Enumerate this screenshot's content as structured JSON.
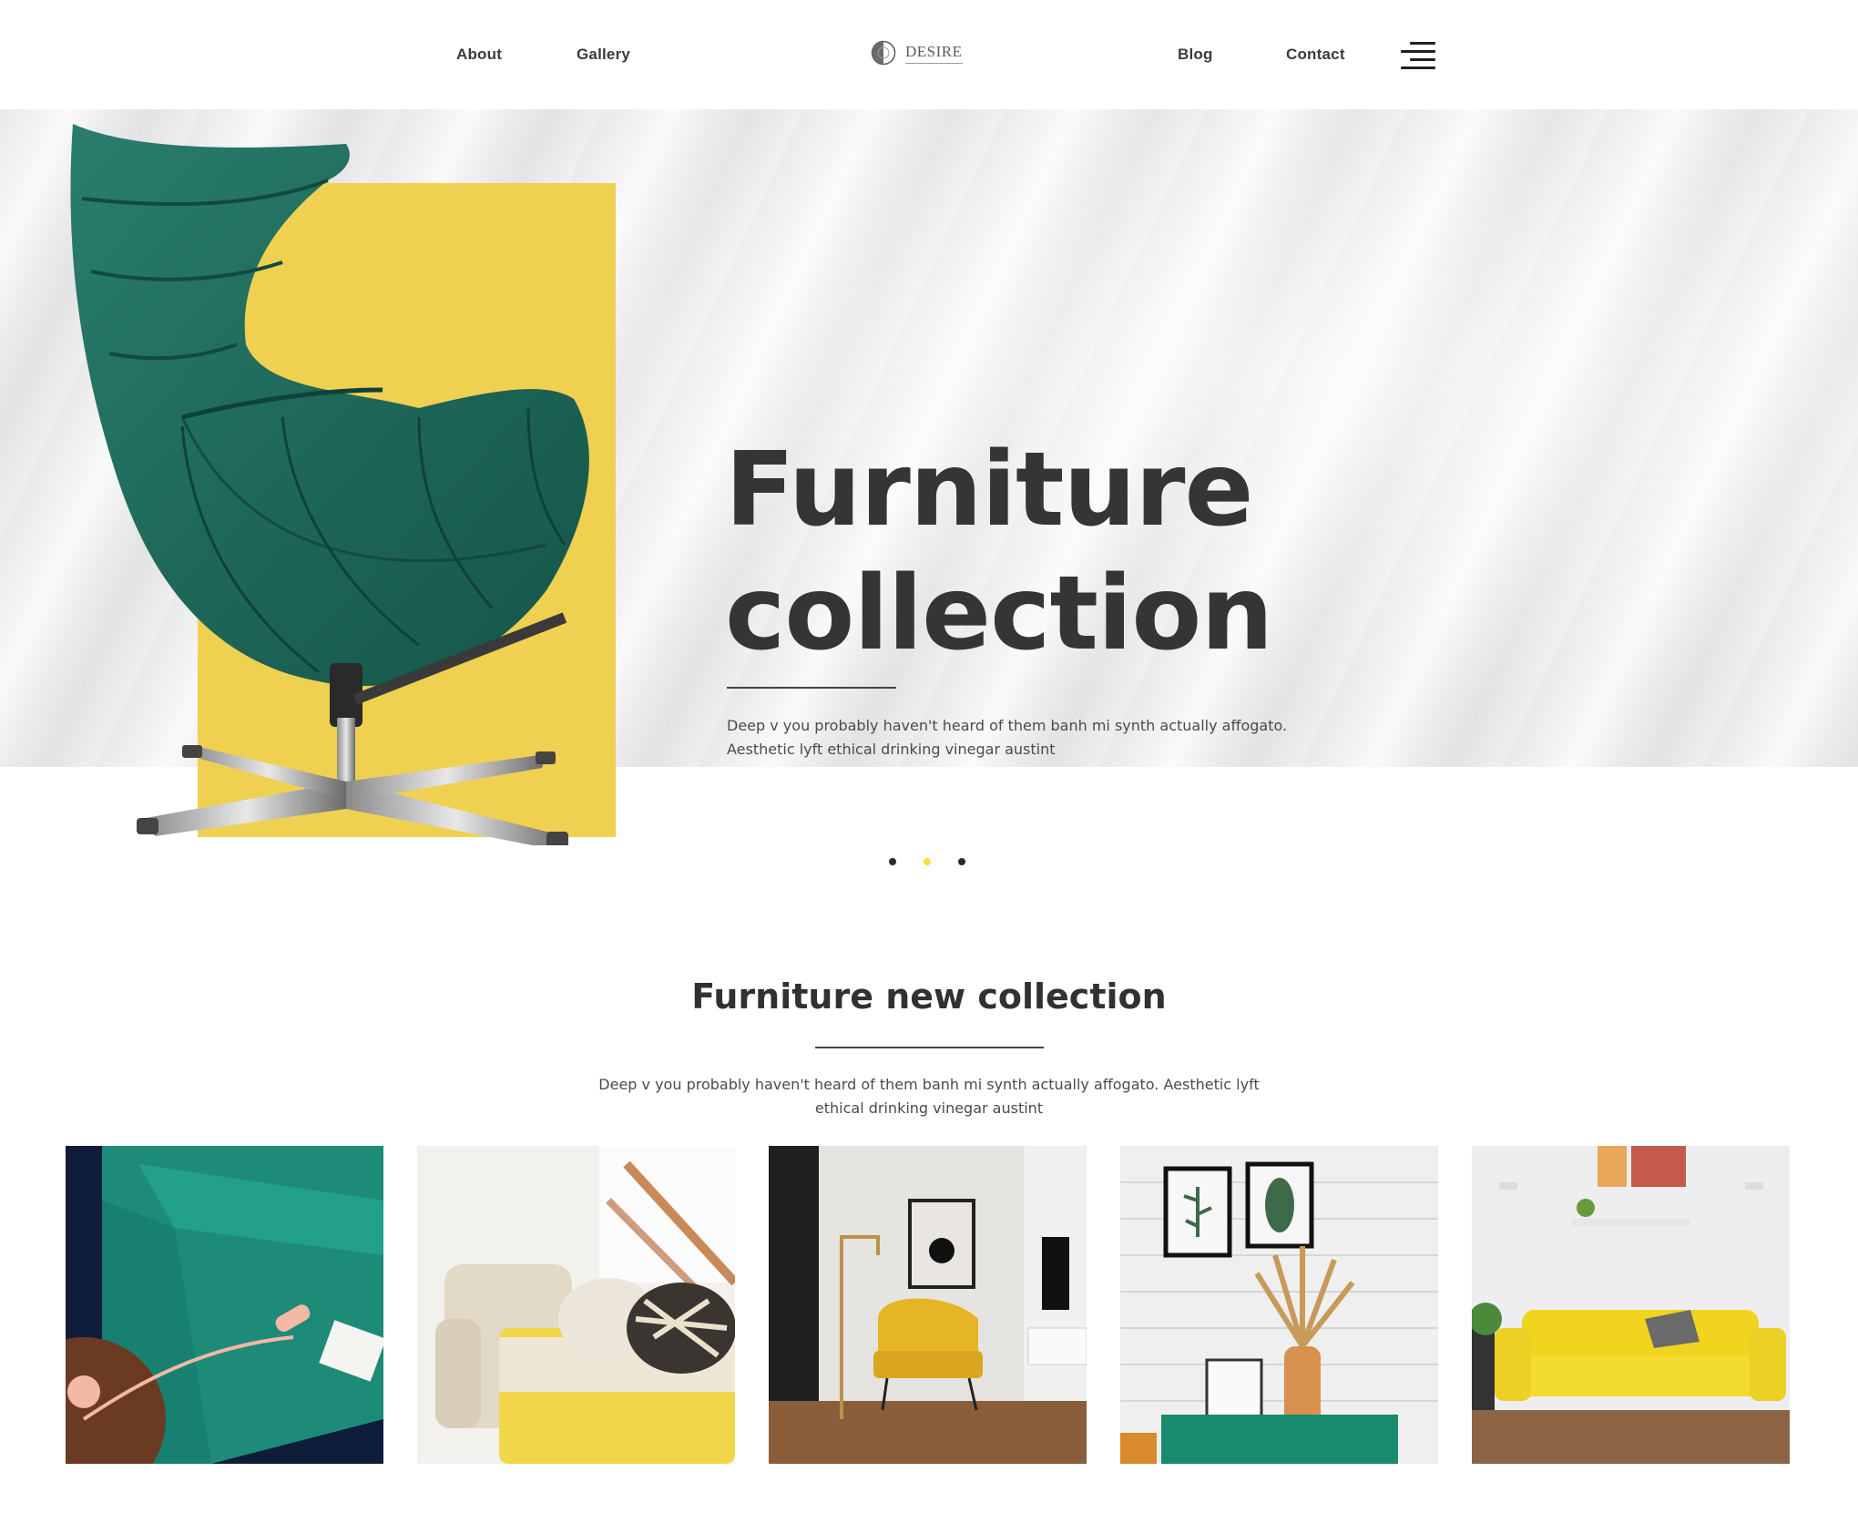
{
  "nav": {
    "left_links": [
      "About",
      "Gallery"
    ],
    "logo_text": "DESIRE",
    "right_links": [
      "Blog",
      "Contact"
    ],
    "menu_icon": "hamburger-menu-icon"
  },
  "hero": {
    "title_line1": "Furniture",
    "title_line2": "collection",
    "description": "Deep v you probably haven't heard of them banh mi synth actually affogato. Aesthetic lyft ethical drinking vinegar austint",
    "accent_color": "#f0d050",
    "chair_color": "#1f6b5c"
  },
  "carousel": {
    "slides": 3,
    "active_index": 1,
    "active_color": "#f2e23a"
  },
  "collection": {
    "title": "Furniture new collection",
    "description": "Deep v you probably haven't heard of them banh mi synth actually affogato. Aesthetic lyft ethical drinking vinegar austint",
    "images": [
      {
        "name": "green-sofa-with-telephone-image"
      },
      {
        "name": "cream-armchair-yellow-sofa-image"
      },
      {
        "name": "yellow-armchair-dark-room-image"
      },
      {
        "name": "green-console-dried-flowers-image"
      },
      {
        "name": "yellow-sofa-white-wall-image"
      }
    ]
  }
}
